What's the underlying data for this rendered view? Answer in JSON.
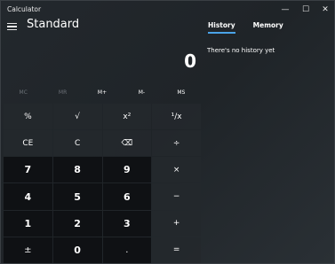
{
  "window": {
    "title": "Calculator",
    "minimize": "—",
    "maximize": "☐",
    "close": "✕"
  },
  "header": {
    "mode": "Standard"
  },
  "display": {
    "value": "0"
  },
  "memory": [
    "MC",
    "MR",
    "M+",
    "M-",
    "MS"
  ],
  "keys": [
    {
      "label": "%",
      "kind": "op"
    },
    {
      "label": "√",
      "kind": "op"
    },
    {
      "label": "x²",
      "kind": "op"
    },
    {
      "label": "¹/x",
      "kind": "op"
    },
    {
      "label": "CE",
      "kind": "op"
    },
    {
      "label": "C",
      "kind": "op"
    },
    {
      "label": "⌫",
      "kind": "op"
    },
    {
      "label": "÷",
      "kind": "op"
    },
    {
      "label": "7",
      "kind": "num"
    },
    {
      "label": "8",
      "kind": "num"
    },
    {
      "label": "9",
      "kind": "num"
    },
    {
      "label": "×",
      "kind": "op"
    },
    {
      "label": "4",
      "kind": "num"
    },
    {
      "label": "5",
      "kind": "num"
    },
    {
      "label": "6",
      "kind": "num"
    },
    {
      "label": "−",
      "kind": "op"
    },
    {
      "label": "1",
      "kind": "num"
    },
    {
      "label": "2",
      "kind": "num"
    },
    {
      "label": "3",
      "kind": "num"
    },
    {
      "label": "+",
      "kind": "op"
    },
    {
      "label": "±",
      "kind": "num-lite"
    },
    {
      "label": "0",
      "kind": "num"
    },
    {
      "label": ".",
      "kind": "num-lite"
    },
    {
      "label": "=",
      "kind": "op"
    }
  ],
  "panel": {
    "tab_history": "History",
    "tab_memory": "Memory",
    "empty_message": "There's no history yet"
  },
  "colors": {
    "accent": "#4aa3e8",
    "background": "#1f2428",
    "number_key": "#0f1114"
  }
}
